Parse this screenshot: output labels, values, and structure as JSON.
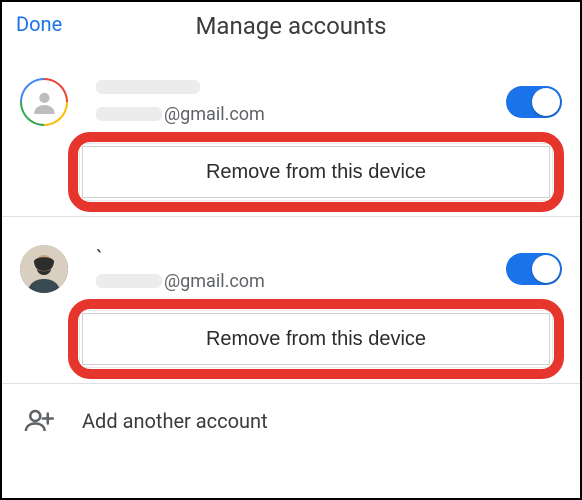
{
  "header": {
    "done": "Done",
    "title": "Manage accounts"
  },
  "accounts": [
    {
      "email_domain": "@gmail.com",
      "toggle_on": true,
      "remove_label": "Remove from this device"
    },
    {
      "email_domain": "@gmail.com",
      "toggle_on": true,
      "remove_label": "Remove from this device"
    }
  ],
  "add_label": "Add another account"
}
